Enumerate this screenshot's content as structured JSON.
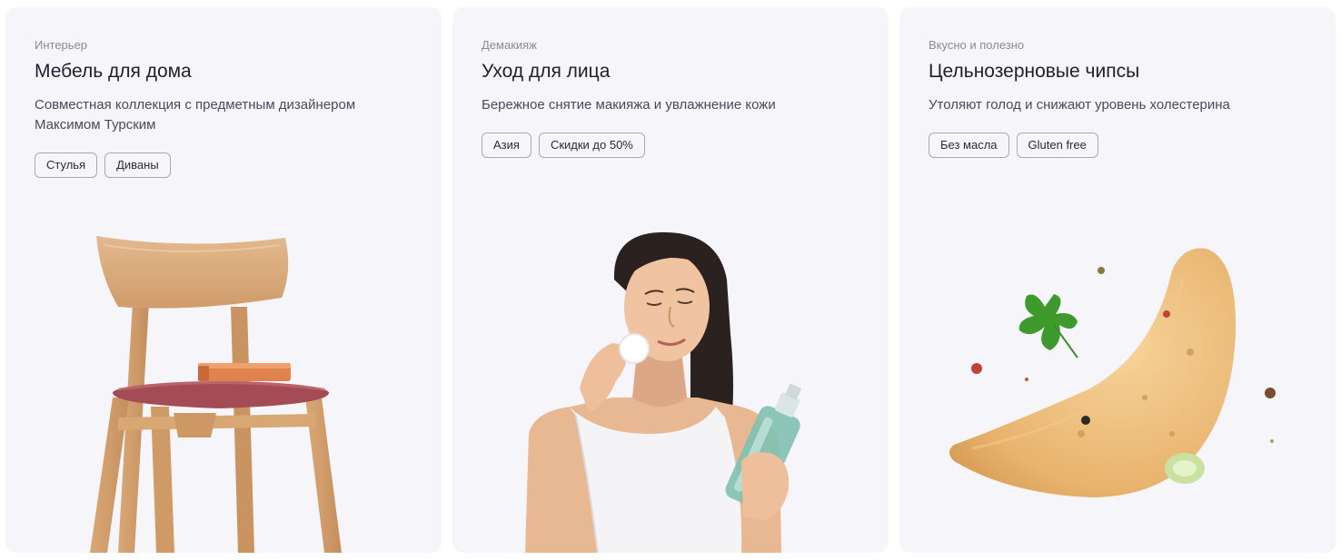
{
  "cards": [
    {
      "kicker": "Интерьер",
      "title": "Мебель для дома",
      "description": "Совместная коллекция с предметным дизайнером Максимом Турским",
      "tags": [
        "Стулья",
        "Диваны"
      ],
      "image": "wooden-chair-with-book"
    },
    {
      "kicker": "Демакияж",
      "title": "Уход для лица",
      "description": "Бережное снятие макияжа и увлажнение кожи",
      "tags": [
        "Азия",
        "Скидки до 50%"
      ],
      "image": "woman-removing-makeup"
    },
    {
      "kicker": "Вкусно и полезно",
      "title": "Цельнозерновые чипсы",
      "description": "Утоляют голод и снижают уровень холестерина",
      "tags": [
        "Без масла",
        "Gluten free"
      ],
      "image": "potato-chip-with-herbs"
    }
  ],
  "colors": {
    "card_bg": "#f6f6fa",
    "text": "#1f1f2b",
    "muted": "#8a8a98",
    "tag_border": "#a9a9b6"
  }
}
